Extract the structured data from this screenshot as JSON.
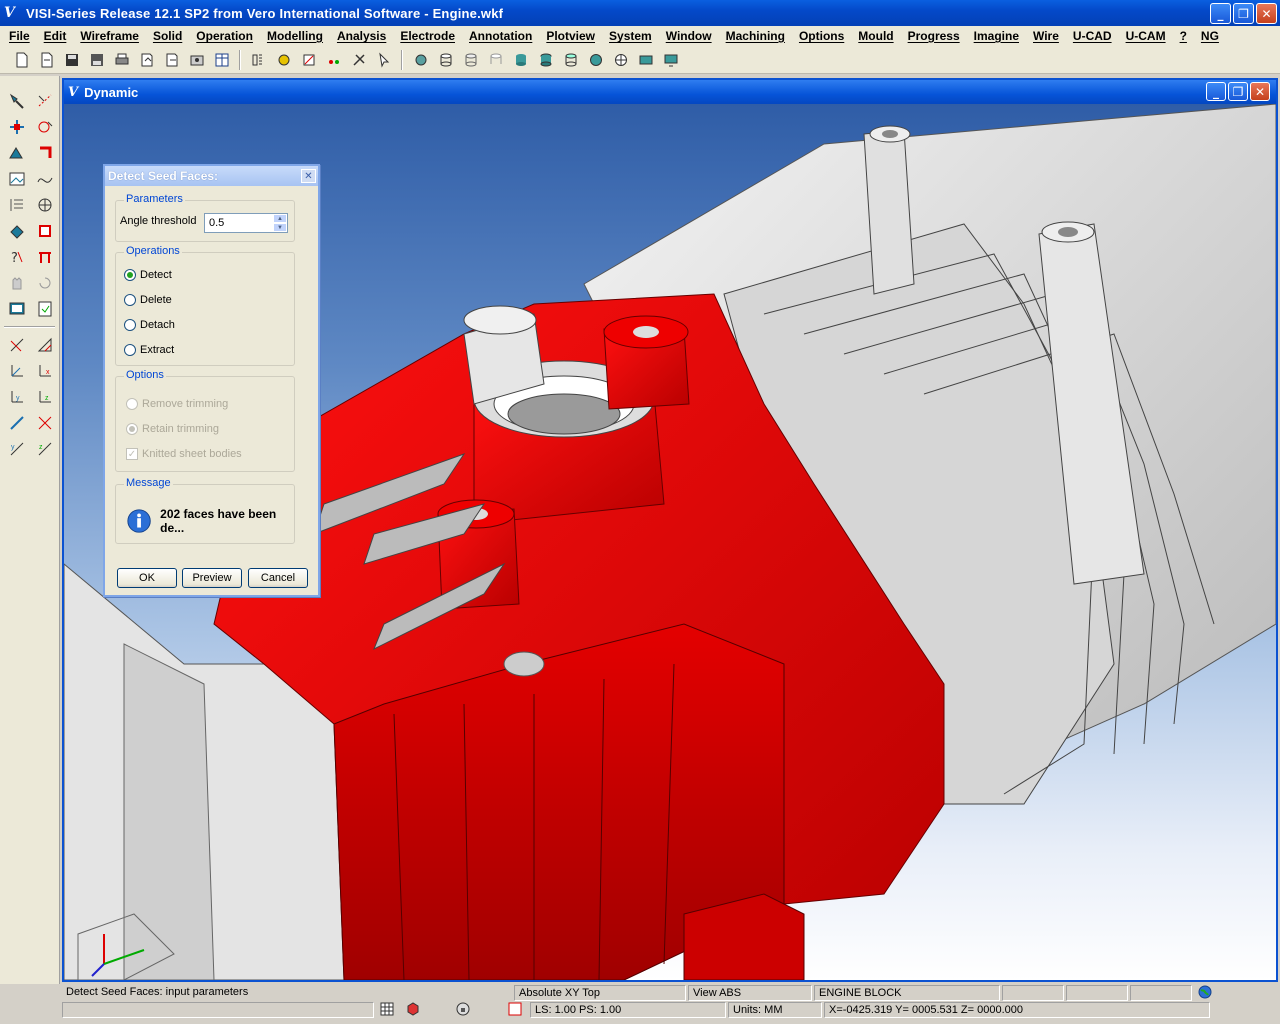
{
  "app": {
    "title": "VISI-Series Release 12.1 SP2 from Vero International Software - Engine.wkf",
    "logo_letter": "V"
  },
  "window_buttons": {
    "minimize": "_",
    "maximize": "❐",
    "close": "✕"
  },
  "menu": [
    "File",
    "Edit",
    "Wireframe",
    "Solid",
    "Operation",
    "Modelling",
    "Analysis",
    "Electrode",
    "Annotation",
    "Plotview",
    "System",
    "Window",
    "Machining",
    "Options",
    "Mould",
    "Progress",
    "Imagine",
    "Wire",
    "U-CAD",
    "U-CAM",
    "?",
    "NG"
  ],
  "viewport_window": {
    "title": "Dynamic",
    "logo_letter": "V"
  },
  "dialog": {
    "title": "Detect Seed Faces:",
    "parameters_label": "Parameters",
    "angle_label": "Angle threshold",
    "angle_value": "0.5",
    "operations_label": "Operations",
    "operations": [
      "Detect",
      "Delete",
      "Detach",
      "Extract"
    ],
    "selected_operation": "Detect",
    "options_label": "Options",
    "opt_remove_trimming": "Remove trimming",
    "opt_retain_trimming": "Retain trimming",
    "opt_knitted": "Knitted sheet bodies",
    "message_label": "Message",
    "message_text": "202 faces have been de...",
    "ok": "OK",
    "preview": "Preview",
    "cancel": "Cancel"
  },
  "status": {
    "prompt": "Detect Seed Faces: input parameters",
    "view_plane": "Absolute XY Top",
    "view_name": "View ABS",
    "layer": "ENGINE BLOCK",
    "ls_ps": "LS: 1.00 PS: 1.00",
    "units": "Units: MM",
    "coords": "X=-0425.319 Y= 0005.531 Z= 0000.000"
  },
  "colors": {
    "highlight_red": "#e00000",
    "model_grey": "#d8d8d8",
    "title_blue": "#0449c9"
  }
}
